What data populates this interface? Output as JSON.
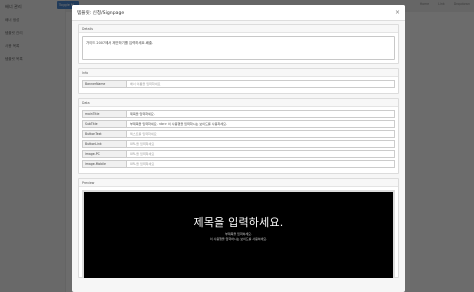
{
  "app": {
    "sidebar_items": [
      "배너 관리",
      "배너 생성",
      "템플릿 관리",
      "사용 목록",
      "템플릿 목록"
    ],
    "toggle_label": "Toggle M...",
    "crumbs": [
      "Home",
      "Link",
      "Dropdown"
    ]
  },
  "modal": {
    "title": "템플릿: 신청/Signpage",
    "details": {
      "header": "Details",
      "value": "가이드 2007에서 제안하기를 입력하세요.배출."
    },
    "info": {
      "header": "Info",
      "rows": [
        {
          "label": "BannerName",
          "value": "배너 이름을 입력하세요",
          "filled": false
        }
      ]
    },
    "data": {
      "header": "Data",
      "rows": [
        {
          "label": "mainTitle",
          "value": "제목을 입력하세요.",
          "filled": true
        },
        {
          "label": "SubTitle",
          "value": "부제목을 입력하세요. <br> 이 사용행을 입력하시는 보이드를 사용하세요.",
          "filled": true
        },
        {
          "label": "ButtonText",
          "value": "텍스트를 입력하세요",
          "filled": false
        },
        {
          "label": "ButtonLink",
          "value": "URL을 입력하세요",
          "filled": false
        },
        {
          "label": "image-PC",
          "value": "URL을 입력하세요",
          "filled": false
        },
        {
          "label": "image-Mobile",
          "value": "URL을 입력하세요",
          "filled": false
        }
      ]
    },
    "preview": {
      "header": "Preview",
      "title": "제목을 입력하세요.",
      "sub1": "부제목을 입력하세요.",
      "sub2": "이 사용행을 입력하시는 보이드를 사용하세요."
    }
  },
  "colors": {
    "accent": "#4a83c8",
    "overlay": "rgba(0,0,0,0.55)"
  }
}
